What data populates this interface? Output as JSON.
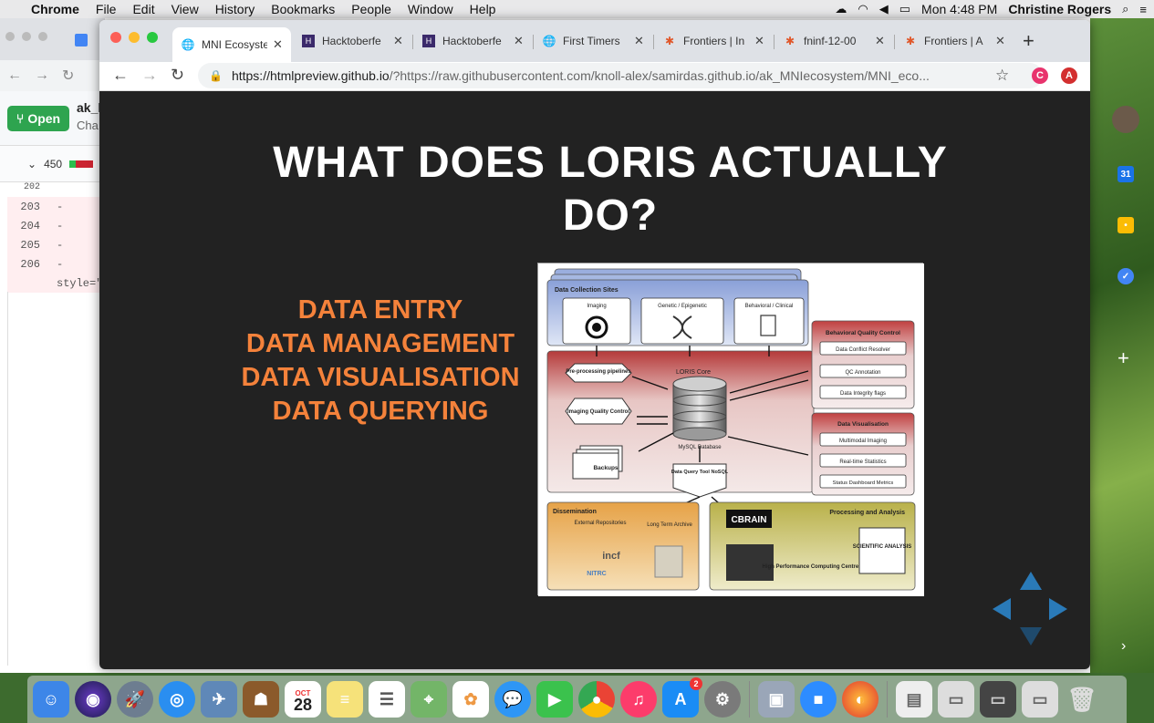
{
  "menubar": {
    "app": "Chrome",
    "items": [
      "File",
      "Edit",
      "View",
      "History",
      "Bookmarks",
      "People",
      "Window",
      "Help"
    ],
    "clock": "Mon 4:48 PM",
    "user": "Christine Rogers"
  },
  "background_window": {
    "open_button": "Open",
    "title": "ak_l",
    "subtitle": "Cha",
    "diff_count": "450",
    "lines": [
      {
        "num": "202",
        "code": ""
      },
      {
        "num": "203",
        "code": "-"
      },
      {
        "num": "204",
        "code": "-"
      },
      {
        "num": "205",
        "code": "-"
      },
      {
        "num": "206",
        "code": "-"
      },
      {
        "num": "",
        "code": "style=\""
      }
    ]
  },
  "tabs": [
    {
      "title": "MNI Ecosyste",
      "active": true
    },
    {
      "title": "Hacktoberfe",
      "active": false
    },
    {
      "title": "Hacktoberfe",
      "active": false
    },
    {
      "title": "First Timers",
      "active": false
    },
    {
      "title": "Frontiers | In",
      "active": false
    },
    {
      "title": "fninf-12-00",
      "active": false
    },
    {
      "title": "Frontiers | A",
      "active": false
    }
  ],
  "address": {
    "host": "https://htmlpreview.github.io",
    "path": "/?https://raw.githubusercontent.com/knoll-alex/samirdas.github.io/ak_MNIecosystem/MNI_eco..."
  },
  "extensions": [
    "C",
    "A"
  ],
  "slide": {
    "title": "WHAT DOES LORIS ACTUALLY DO?",
    "bullets": [
      "DATA ENTRY",
      "DATA MANAGEMENT",
      "DATA VISUALISATION",
      "DATA QUERYING"
    ]
  },
  "diagram": {
    "collection_title": "Data Collection Sites",
    "sources": [
      "Imaging",
      "Genetic / Epigenetic",
      "Behavioral / Clinical"
    ],
    "core_title": "LORIS Core",
    "preproc": "Pre-processing pipelines",
    "imgqc": "Imaging Quality Control",
    "db_label": "MySQL Database",
    "backups": "Backups",
    "dqt": "Data Query Tool NoSQL",
    "bqc_title": "Behavioral Quality Control",
    "bqc_items": [
      "Data Conflict Resolver",
      "QC Annotation",
      "Data Integrity flags"
    ],
    "vis_title": "Data Visualisation",
    "vis_items": [
      "Multimodal Imaging",
      "Real-time Statistics",
      "Status Dashboard Metrics"
    ],
    "dissemination_title": "Dissemination",
    "ext_repos": "External Repositories",
    "lta": "Long Term Archive",
    "incf": "incf",
    "nitrc": "NITRC",
    "processing_title": "Processing and Analysis",
    "cbrain": "CBRAIN",
    "hpc": "High Performance Computing Centres",
    "sci": "SCIENTIFIC ANALYSIS"
  },
  "colors": {
    "accent": "#f4823b",
    "slide_bg": "#222222",
    "github_green": "#2ea44f"
  },
  "dock_badge": "2",
  "calendar_day": "28",
  "calendar_month": "OCT"
}
